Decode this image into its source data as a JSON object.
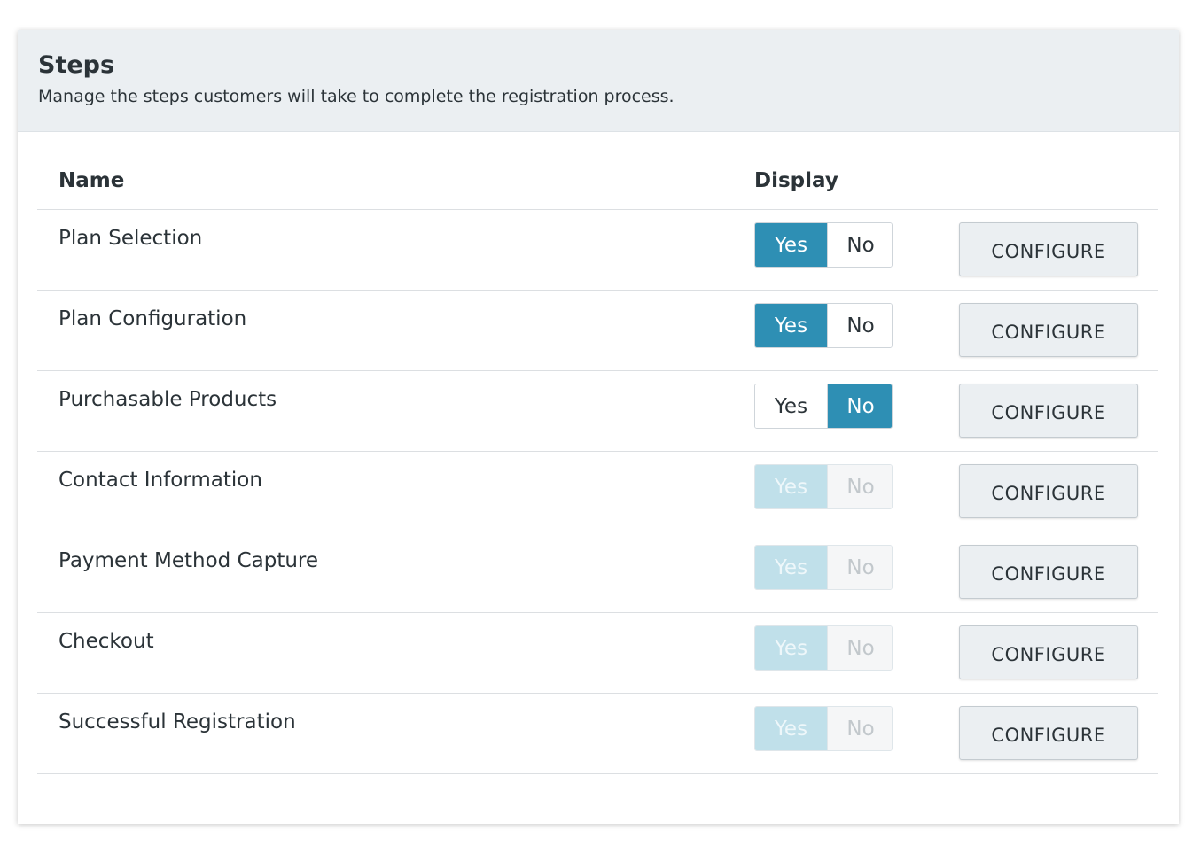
{
  "header": {
    "title": "Steps",
    "subtitle": "Manage the steps customers will take to complete the registration process."
  },
  "table": {
    "columns": {
      "name": "Name",
      "display": "Display"
    },
    "yes_label": "Yes",
    "no_label": "No",
    "configure_label": "CONFIGURE",
    "rows": [
      {
        "name": "Plan Selection",
        "display": "Yes",
        "disabled": false
      },
      {
        "name": "Plan Configuration",
        "display": "Yes",
        "disabled": false
      },
      {
        "name": "Purchasable Products",
        "display": "No",
        "disabled": false
      },
      {
        "name": "Contact Information",
        "display": "Yes",
        "disabled": true
      },
      {
        "name": "Payment Method Capture",
        "display": "Yes",
        "disabled": true
      },
      {
        "name": "Checkout",
        "display": "Yes",
        "disabled": true
      },
      {
        "name": "Successful Registration",
        "display": "Yes",
        "disabled": true
      }
    ]
  },
  "colors": {
    "accent": "#2e8fb4",
    "accent_disabled": "#c0e0ea",
    "header_bg": "#ebeff2"
  }
}
